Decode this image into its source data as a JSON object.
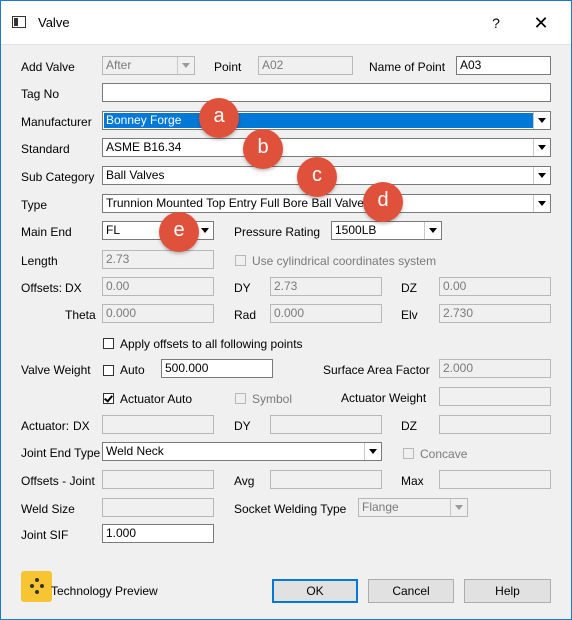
{
  "window": {
    "title": "Valve",
    "help": "?",
    "close": "✕"
  },
  "labels": {
    "add_valve": "Add Valve",
    "point": "Point",
    "name_of_point": "Name of Point",
    "tag_no": "Tag No",
    "manufacturer": "Manufacturer",
    "standard": "Standard",
    "sub_category": "Sub Category",
    "type": "Type",
    "main_end": "Main End",
    "pressure_rating": "Pressure Rating",
    "length": "Length",
    "use_cylindrical": "Use cylindrical coordinates system",
    "offsets": "Offsets:",
    "dx": "DX",
    "dy": "DY",
    "dz": "DZ",
    "theta": "Theta",
    "rad": "Rad",
    "elv": "Elv",
    "apply_offsets": "Apply offsets to all following points",
    "valve_weight": "Valve Weight",
    "auto": "Auto",
    "surface_area_factor": "Surface Area Factor",
    "actuator_auto": "Actuator Auto",
    "symbol": "Symbol",
    "actuator_weight": "Actuator Weight",
    "actuator": "Actuator:",
    "joint_end_type": "Joint End Type",
    "concave": "Concave",
    "offsets_joint": "Offsets - Joint",
    "avg": "Avg",
    "max": "Max",
    "weld_size": "Weld Size",
    "socket_welding_type": "Socket Welding Type",
    "joint_sif": "Joint SIF",
    "technology_preview": "Technology Preview"
  },
  "values": {
    "add_valve": "After",
    "point": "A02",
    "name_of_point": "A03",
    "tag_no": "",
    "manufacturer": "Bonney Forge",
    "standard": "ASME B16.34",
    "sub_category": "Ball Valves",
    "type": "Trunnion Mounted Top Entry Full Bore Ball Valves",
    "main_end": "FL",
    "pressure_rating": "1500LB",
    "length": "2.73",
    "offset_dx": "0.00",
    "offset_dy": "2.73",
    "offset_dz": "0.00",
    "theta": "0.000",
    "rad": "0.000",
    "elv": "2.730",
    "valve_weight": "500.000",
    "surface_area_factor": "2.000",
    "actuator_weight": "",
    "actuator_dx": "",
    "actuator_dy": "",
    "actuator_dz": "",
    "joint_end_type": "Weld Neck",
    "offsets_joint": "",
    "avg": "",
    "max": "",
    "weld_size": "",
    "socket_welding_type": "Flange",
    "joint_sif": "1.000"
  },
  "checkboxes": {
    "use_cylindrical": false,
    "apply_offsets": false,
    "auto": false,
    "actuator_auto": true,
    "symbol": false,
    "concave": false
  },
  "badges": {
    "a": "a",
    "b": "b",
    "c": "c",
    "d": "d",
    "e": "e"
  },
  "buttons": {
    "ok": "OK",
    "cancel": "Cancel",
    "help": "Help"
  },
  "colors": {
    "badge": "#e0513b",
    "selection": "#0078d7",
    "window_border": "#1979ca"
  },
  "icons": {
    "window": "window-icon",
    "preview": "technology-preview-icon"
  }
}
